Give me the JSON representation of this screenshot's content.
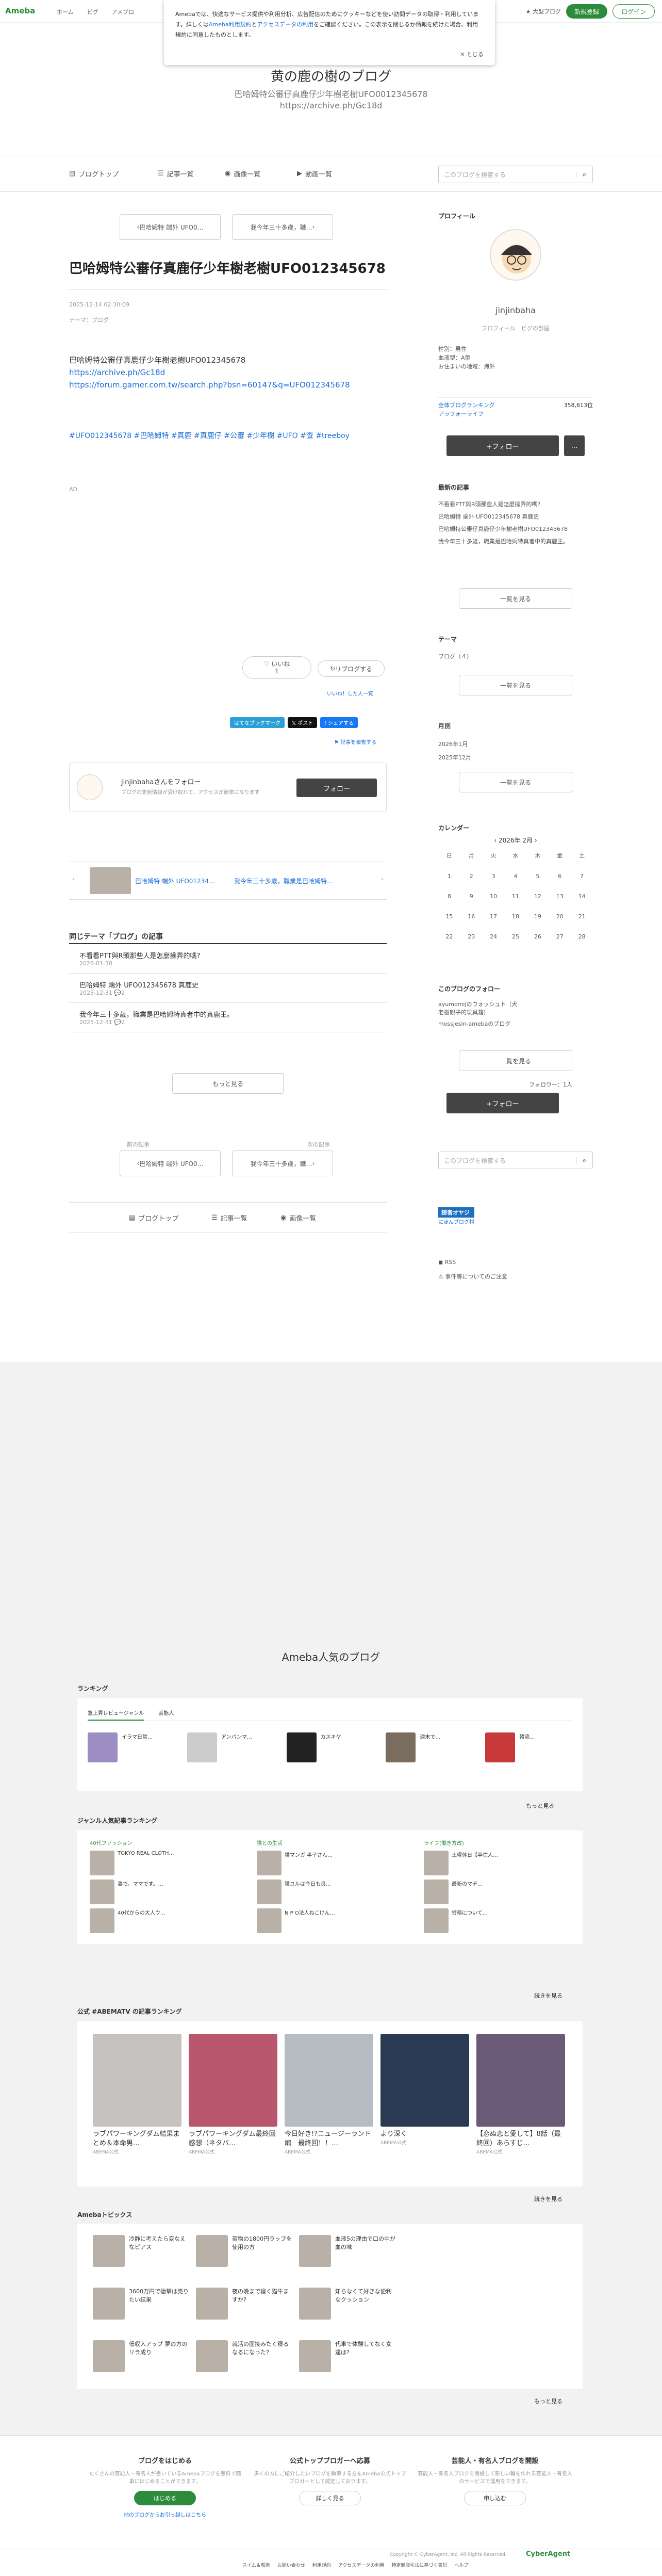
{
  "topbar": {
    "logo": "Ameba",
    "nav": [
      "ホーム",
      "ピグ",
      "アメブロ"
    ],
    "app_label": "Ameba",
    "big_blog": "大型ブログ",
    "register": "新規登録",
    "login": "ログイン"
  },
  "consent": {
    "text1": "Amebaでは、快適なサービス提供や利用分析、広告配信のためにクッキーなどを使い訪問データの取得・利用しています。詳しくは",
    "link1": "Ameba利用規約",
    "mid": "と",
    "link2": "アクセスデータの利用",
    "text2": "をご確認ください。この表示を閉じるか情報を続けた場合、利用規約に同意したものとします。",
    "close": "とじる"
  },
  "blog": {
    "title": "黄の鹿の樹のブログ",
    "desc1": "巴哈姆特公審仔真鹿仔少年樹老樹UFO0012345678",
    "desc2": "https://archive.ph/Gc18d"
  },
  "gnav": {
    "top": "ブログトップ",
    "list": "記事一覧",
    "images": "画像一覧",
    "videos": "動画一覧",
    "search_placeholder": "このブログを検索する"
  },
  "article": {
    "prev": "巴哈姆特 端外 UFO0…",
    "next": "我今年三十多歲，職…",
    "title": "巴哈姆特公審仔真鹿仔少年樹老樹UFO012345678",
    "date": "2025-12-14 02:30:09",
    "theme": "テーマ：ブログ",
    "body": "巴哈姆特公審仔真鹿仔少年樹老樹UFO012345678",
    "link1": "https://archive.ph/Gc18d",
    "link2": "https://forum.gamer.com.tw/search.php?bsn=60147&q=UFO012345678",
    "tags": [
      "#UFO012345678",
      "#巴哈姆特",
      "#真鹿",
      "#真鹿仔",
      "#公審",
      "#少年樹",
      "#UFO",
      "#查",
      "#treeboy"
    ],
    "ad": "AD",
    "like": "いいね",
    "like_count": "1",
    "reblog": "リブログする",
    "liked_users": "いいね！した人一覧",
    "share_btns": [
      "はてなブックマーク",
      "ポスト",
      "シェアする"
    ],
    "report": "記事を報告する",
    "follow_name": "jinjinbahaさんをフォロー",
    "follow_desc": "ブログの更新情報が受け取れて、アクセスが簡単になります",
    "follow_btn": "フォロー"
  },
  "related": {
    "prev": "巴哈姆特 端外 UFO01234…",
    "next": "我今年三十多歲，職業是巴哈姆特…",
    "heading": "同じテーマ「ブログ」の記事",
    "items": [
      {
        "title": "不看看PTT與R頭那些人是怎麼操弄的嗎?",
        "date": "2026-01-30"
      },
      {
        "title": "巴哈姆特 端外 UFO012345678 真鹿史",
        "date": "2025-12-31",
        "count": "2"
      },
      {
        "title": "我今年三十多歲，職業是巴哈姆特真者中的真鹿王。",
        "date": "2025-12-31",
        "count": "2"
      }
    ],
    "more": "もっと見る",
    "prev_label": "前の記事",
    "next_label": "次の記事",
    "prev2": "巴哈姆特 端外 UFO0…",
    "next2": "我今年三十多歲，職…"
  },
  "bottomnav": {
    "top": "ブログトップ",
    "list": "記事一覧",
    "images": "画像一覧"
  },
  "profile": {
    "heading": "プロフィール",
    "name": "jinjinbaha",
    "links": "プロフィール　ピグの部屋",
    "gender": "性別：男性",
    "blood": "血液型：A型",
    "location": "お住まいの地域：海外",
    "ranking": "全体ブログランキング",
    "rank_val": "358,613位",
    "ranking2": "アラフォーライフ",
    "follow": "+フォロー",
    "menu": "…"
  },
  "recent": {
    "heading": "最新の記事",
    "items": [
      "不看看PTT與R頭那些人是怎麼操弄的嗎?",
      "巴哈姆特 端外 UFO012345678 真鹿史",
      "巴哈姆特公審仔真鹿仔少年樹老樹UFO012345678",
      "我今年三十多歲，職業是巴哈姆特真者中的真鹿王。"
    ],
    "more": "一覧を見る"
  },
  "theme": {
    "heading": "テーマ",
    "item": "ブログ（４）",
    "more": "一覧を見る"
  },
  "monthly": {
    "heading": "月別",
    "items": [
      "2026年1月",
      "2025年12月"
    ],
    "more": "一覧を見る"
  },
  "calendar": {
    "heading": "カレンダー",
    "month": "2026年 2月",
    "days": [
      "日",
      "月",
      "火",
      "水",
      "木",
      "金",
      "土"
    ],
    "dates": [
      "1",
      "2",
      "3",
      "4",
      "5",
      "6",
      "7",
      "8",
      "9",
      "10",
      "11",
      "12",
      "13",
      "14",
      "15",
      "16",
      "17",
      "18",
      "19",
      "20",
      "21",
      "22",
      "23",
      "24",
      "25",
      "26",
      "27",
      "28"
    ]
  },
  "following": {
    "heading": "このブログのフォロー",
    "items": [
      "ayumomijのウォッシュト（犬老樹親子的玩具箱)",
      "mossjesin-amebaのブログ"
    ],
    "more": "一覧を見る",
    "followers": "フォロワー：1人",
    "follow": "+フォロー"
  },
  "side2": {
    "search_placeholder": "このブログを検索する",
    "badge": "読者オヤジ",
    "badge_sub": "にほんブログ村",
    "rss": "RSS",
    "notice": "事件等についてのご注意"
  },
  "popular": {
    "heading": "Ameba人気のブログ",
    "ranking": "ランキング",
    "tabs": [
      "急上昇レビュージャンル",
      "芸能人"
    ],
    "rank_items": [
      "イラマ日常…",
      "アンパンマ…",
      "カスキヤ",
      "週末で…",
      "韓流…"
    ],
    "more": "もっと見る",
    "genre_heading": "ジャンル人気記事ランキング",
    "genres": [
      {
        "name": "40代ファッション",
        "items": [
          "TOKYO REAL CLOTH…",
          "妻で。ママです。…",
          "40代からの大人ウ…"
        ]
      },
      {
        "name": "猫との生活",
        "items": [
          "猫マンガ 半子さん…",
          "猫ユルは今日も良…",
          "N P O法人ねこけん…"
        ]
      },
      {
        "name": "ライフ(働き方改)",
        "items": [
          "土曜休日【半住人…",
          "最新のマデ…",
          "労務について…"
        ]
      }
    ],
    "more2": "続きを見る"
  },
  "abema": {
    "heading": "公式 #ABEMATV の記事ランキング",
    "items": [
      {
        "title": "ラブパワーキングダム結果まとめ＆本命男…",
        "sub": "ABEMA公式"
      },
      {
        "title": "ラブパワーキングダム最終回感想（ネタバ…",
        "sub": "ABEMA公式"
      },
      {
        "title": "今日好き!?ニュージーランド編　最終回！！…",
        "sub": "ABEMA公式"
      },
      {
        "title": "より深く",
        "sub": "ABEMA公式"
      },
      {
        "title": "【恋ぬ恋と愛して】8話（最終回）あらすじ…",
        "sub": "ABEMA公式"
      }
    ],
    "more": "続きを見る"
  },
  "topics": {
    "heading": "Amebaトピックス",
    "items": [
      "冷静に考えたら変なえなピアス",
      "荷物の1800円ラップを使用の方",
      "血液5の理由で口の中が血の味",
      "3600万円で衝撃は売りたい結果",
      "夜の晩まで寝く猫牛ますか?",
      "知らなくて好きな便利なクッション",
      "低収入アップ 夢の方のリラ成り",
      "就活の面接みたく寝るなるになった？",
      "代車で体験してなく女達は?"
    ],
    "more": "もっと見る"
  },
  "promo": [
    {
      "heading": "ブログをはじめる",
      "desc": "たくさんの芸能人・有名人が書いているAmebaブログを無料で簡単にはじめることができます。",
      "btn": "はじめる",
      "sub": "他のブログからお引っ越しはこちら"
    },
    {
      "heading": "公式トップブロガーへ応募",
      "desc": "多くの方にご紹介したいブログを執筆する方をAmeba公式トップブロガーとして認定しております。",
      "btn": "詳しく見る"
    },
    {
      "heading": "芸能人・有名人ブログを開設",
      "desc": "芸能人・有名人ブログを開設して新しい輪を作れる芸能人・有名人のサービスで運用をできます。",
      "btn": "申し込む"
    }
  ],
  "footer": {
    "links": [
      "スイム＆報告",
      "お問い合わせ",
      "利用規約",
      "アクセスデータの利用",
      "特定商取引法に基づく表記",
      "ヘルプ"
    ],
    "copyright": "Copyright © CyberAgent, Inc. All Rights Reserved.",
    "brand": "CyberAgent"
  }
}
